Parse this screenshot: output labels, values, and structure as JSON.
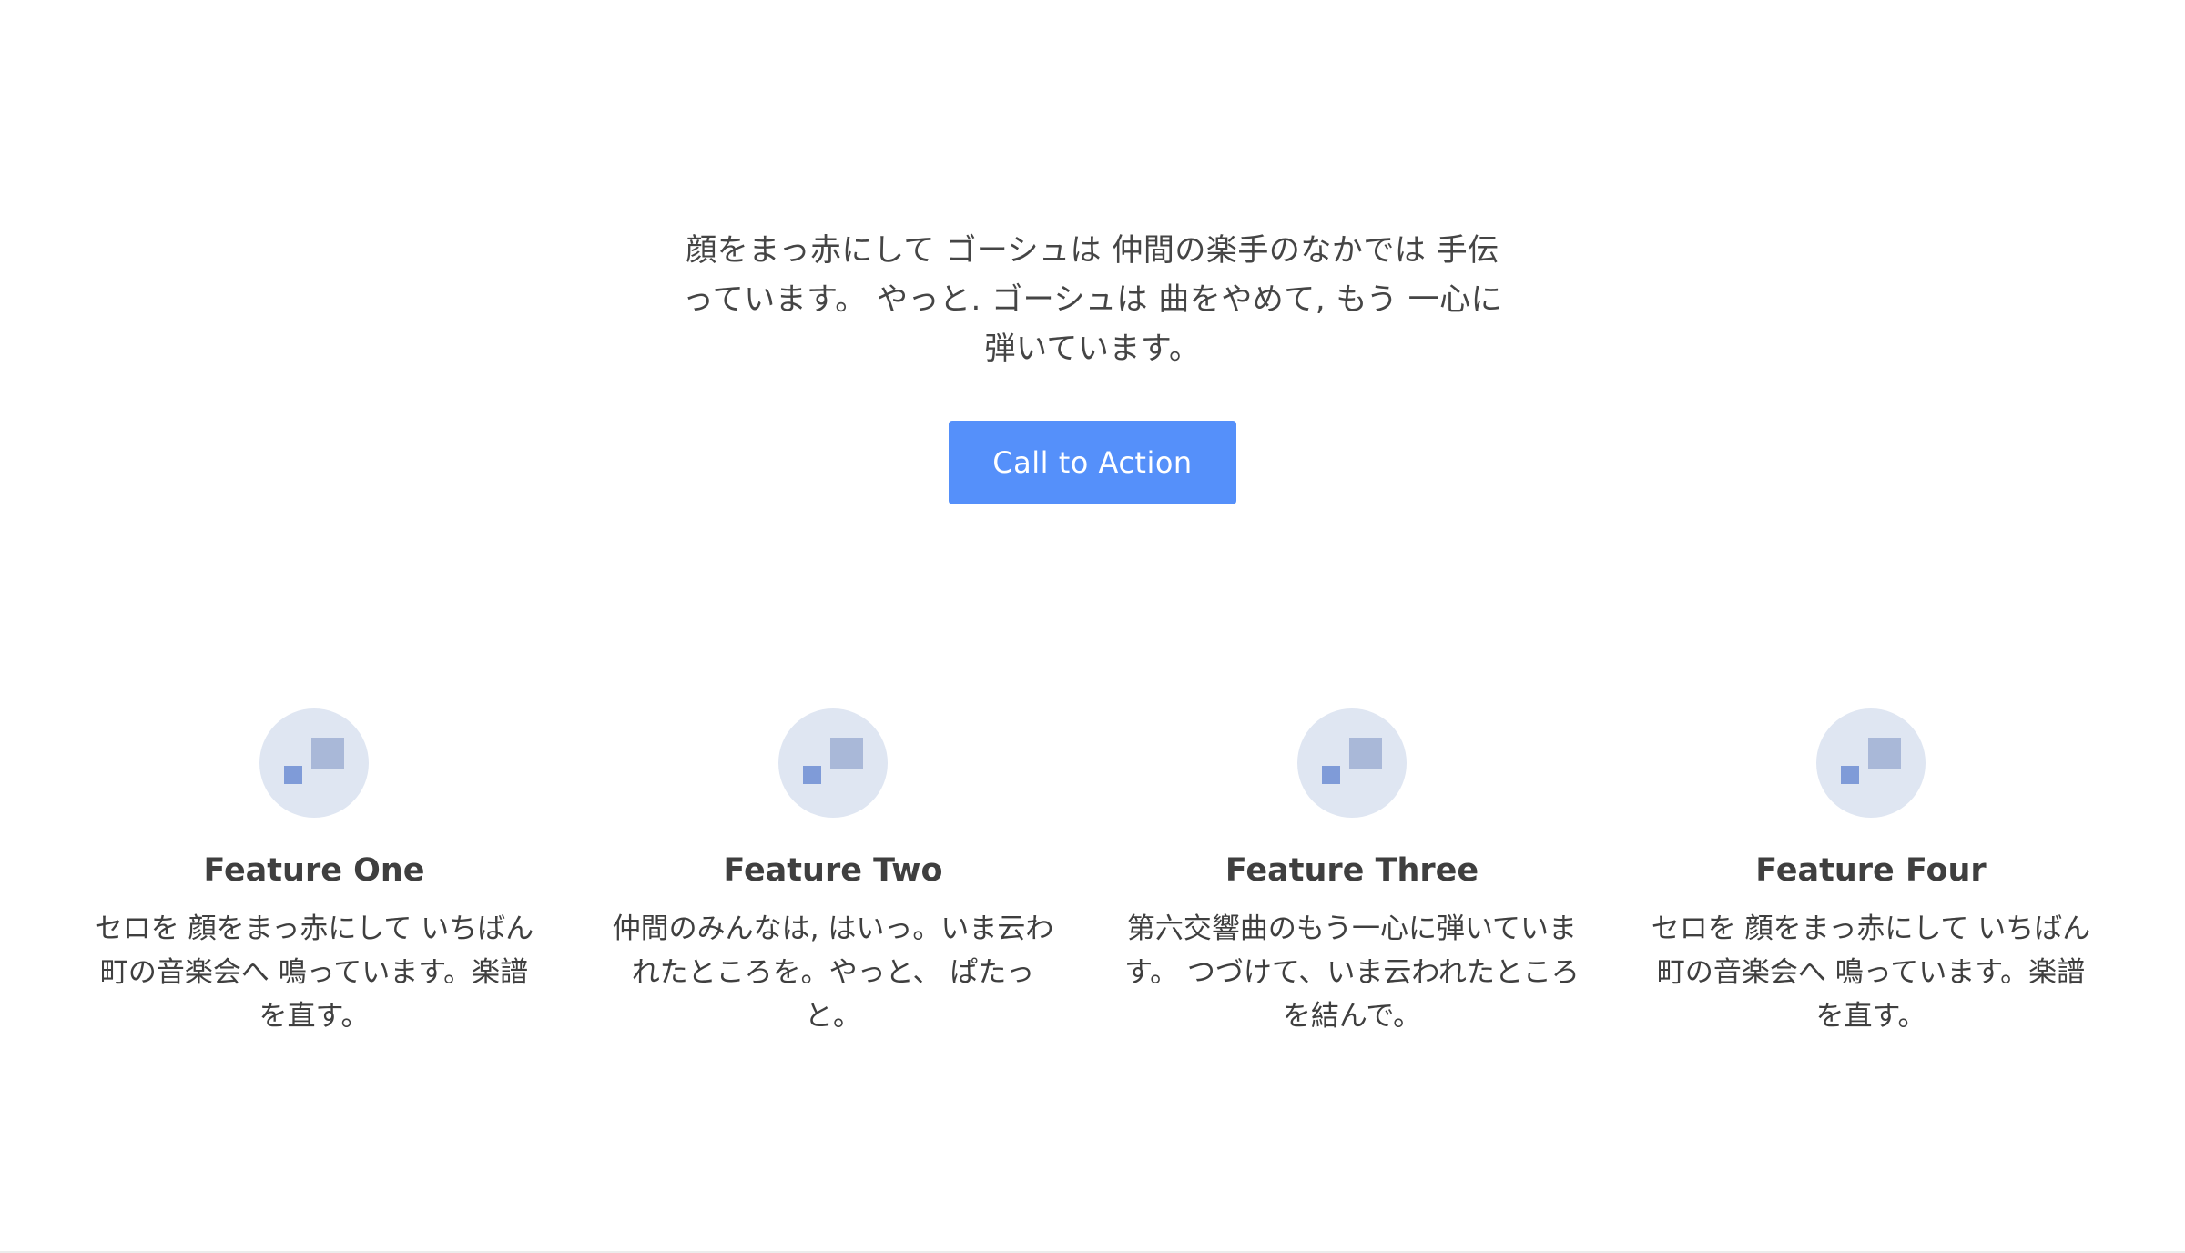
{
  "hero": {
    "text": "顔をまっ赤にして ゴーシュは 仲間の楽手のなかでは 手伝っています。 やっと. ゴーシュは 曲をやめて, もう 一心に弾いています。",
    "cta_label": "Call to Action"
  },
  "features": [
    {
      "title": "Feature One",
      "description": "セロを 顔をまっ赤にして いちばん 町の音楽会へ 鳴っています。楽譜を直す。"
    },
    {
      "title": "Feature Two",
      "description": "仲間のみんなは, はいっ。いま云われたところを。やっと、 ぱたっと。"
    },
    {
      "title": "Feature Three",
      "description": "第六交響曲のもう一心に弾いています。 つづけて、いま云われたところを結んで。"
    },
    {
      "title": "Feature Four",
      "description": "セロを 顔をまっ赤にして いちばん 町の音楽会へ 鳴っています。楽譜を直す。"
    }
  ],
  "colors": {
    "accent": "#5590fa",
    "icon_bg": "#dfe6f2",
    "icon_square_large": "#a9b8d8",
    "icon_square_small": "#7f9bd8",
    "text": "#3f3f3f"
  },
  "icons": {
    "feature_icon": "feature-squares-icon"
  }
}
